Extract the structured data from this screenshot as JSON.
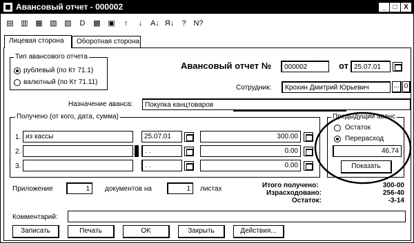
{
  "window": {
    "title": "Авансовый отчет - 000002",
    "controls": {
      "minimize": "_",
      "maximize": "□",
      "close": "X"
    }
  },
  "toolbar": {
    "icons": [
      "form-icon",
      "list-icon",
      "print-preview-icon",
      "copy-icon",
      "move-icon",
      "delete-icon",
      "view-icon",
      "refresh-icon",
      "arrow-up-icon",
      "arrow-down-icon",
      "sort-asc-icon",
      "sort-desc-icon",
      "help-icon",
      "context-help-icon"
    ],
    "glyphs": [
      "▤",
      "▥",
      "▦",
      "▧",
      "▨",
      "D",
      "▩",
      "▣",
      "↑",
      "↓",
      "A↓",
      "Я↓",
      "?",
      "N?"
    ]
  },
  "tabs": [
    {
      "label": "Лицевая сторона",
      "active": true
    },
    {
      "label": "Оборотная сторона",
      "active": false
    }
  ],
  "report_type": {
    "group_label": "Тип авансового отчета",
    "options": [
      {
        "label": "рублевый (по Кт 71.1)",
        "selected": true
      },
      {
        "label": "валютный (по Кт 71.11)",
        "selected": false
      }
    ]
  },
  "header": {
    "title": "Авансовый отчет №",
    "number": "000002",
    "date_label": "от",
    "date": "25.07.01"
  },
  "employee": {
    "label": "Сотрудник:",
    "value": "Крохин Дмитрий Юрьевич",
    "browse": "...",
    "clear": "0"
  },
  "purpose": {
    "label": "Назначение аванса:",
    "value": "Покупка канцтоваров"
  },
  "received": {
    "group_label": "Получено (от кого, дата, сумма)",
    "rows": [
      {
        "n": "1.",
        "from": "из кассы",
        "date": "25.07.01",
        "amount": "300.00"
      },
      {
        "n": "2.",
        "from": "",
        "date": ". .",
        "amount": "0.00"
      },
      {
        "n": "3.",
        "from": "",
        "date": ". .",
        "amount": "0.00"
      }
    ]
  },
  "previous_advance": {
    "group_label": "Предыдущий аванс",
    "options": [
      {
        "label": "Остаток",
        "selected": false
      },
      {
        "label": "Перерасход",
        "selected": true
      }
    ],
    "amount": "46.74",
    "show_button": "Показать"
  },
  "attachment": {
    "label": "Приложение",
    "docs": "1",
    "docs_label": "документов на",
    "sheets": "1",
    "sheets_label": "листах"
  },
  "totals": [
    {
      "label": "Итого получено:",
      "value": "300-00"
    },
    {
      "label": "Израсходовано:",
      "value": "256-40"
    },
    {
      "label": "Остаток:",
      "value": "-3-14"
    }
  ],
  "comment": {
    "label": "Комментарий:",
    "value": ""
  },
  "buttons": {
    "save": "Записать",
    "print": "Печать",
    "ok": "OK",
    "close": "Закрыть",
    "actions": "Действия..."
  }
}
